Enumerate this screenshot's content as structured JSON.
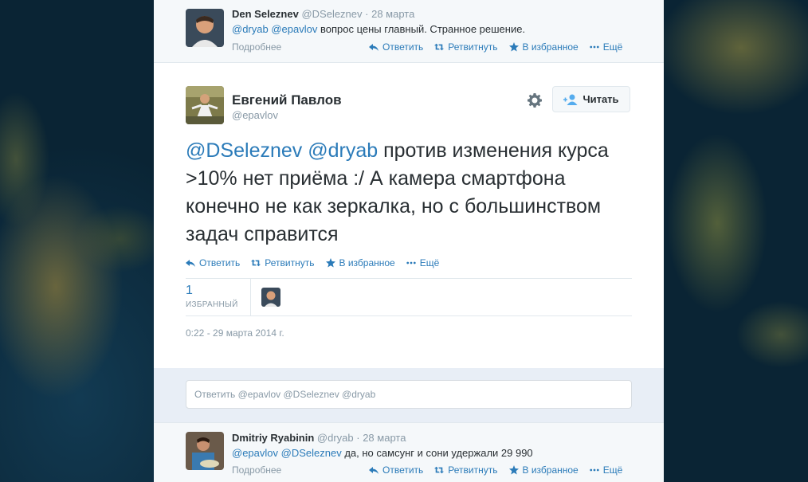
{
  "tweet_top": {
    "name": "Den Seleznev",
    "handle": "@DSeleznev",
    "date": "· 28 марта",
    "mention1": "@dryab",
    "mention2": "@epavlov",
    "text": "вопрос цены главный. Странное решение.",
    "details": "Подробнее"
  },
  "actions": {
    "reply": "Ответить",
    "retweet": "Ретвитнуть",
    "favorite": "В избранное",
    "more": "Ещё"
  },
  "main_tweet": {
    "name": "Евгений Павлов",
    "handle": "@epavlov",
    "follow_label": "Читать",
    "mention1": "@DSeleznev",
    "mention2": "@dryab",
    "text": "против изменения курса >10% нет приёма :/ А камера смартфона конечно не как зеркалка, но с большинством задач справится",
    "favorites_count": "1",
    "favorites_label": "ИЗБРАННЫЙ",
    "timestamp": "0:22 - 29 марта 2014 г."
  },
  "reply_box": {
    "placeholder": "Ответить @epavlov @DSeleznev @dryab"
  },
  "tweet_bottom": {
    "name": "Dmitriy Ryabinin",
    "handle": "@dryab",
    "date": "· 28 марта",
    "mention1": "@epavlov",
    "mention2": "@DSeleznev",
    "text": "да, но самсунг и сони удержали 29 990",
    "details": "Подробнее"
  },
  "colors": {
    "link": "#2b7bb9",
    "muted": "#8899a6",
    "text": "#292f33",
    "reply_bg": "#e8eef6"
  }
}
